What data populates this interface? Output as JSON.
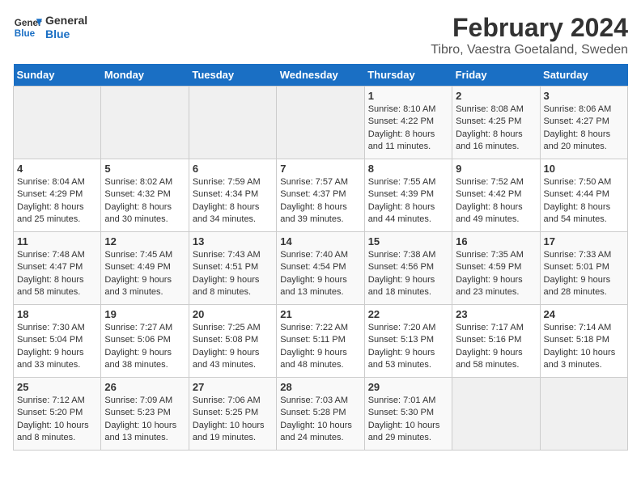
{
  "logo": {
    "text_general": "General",
    "text_blue": "Blue"
  },
  "header": {
    "title": "February 2024",
    "subtitle": "Tibro, Vaestra Goetaland, Sweden"
  },
  "weekdays": [
    "Sunday",
    "Monday",
    "Tuesday",
    "Wednesday",
    "Thursday",
    "Friday",
    "Saturday"
  ],
  "weeks": [
    [
      {
        "day": "",
        "info": ""
      },
      {
        "day": "",
        "info": ""
      },
      {
        "day": "",
        "info": ""
      },
      {
        "day": "",
        "info": ""
      },
      {
        "day": "1",
        "info": "Sunrise: 8:10 AM\nSunset: 4:22 PM\nDaylight: 8 hours\nand 11 minutes."
      },
      {
        "day": "2",
        "info": "Sunrise: 8:08 AM\nSunset: 4:25 PM\nDaylight: 8 hours\nand 16 minutes."
      },
      {
        "day": "3",
        "info": "Sunrise: 8:06 AM\nSunset: 4:27 PM\nDaylight: 8 hours\nand 20 minutes."
      }
    ],
    [
      {
        "day": "4",
        "info": "Sunrise: 8:04 AM\nSunset: 4:29 PM\nDaylight: 8 hours\nand 25 minutes."
      },
      {
        "day": "5",
        "info": "Sunrise: 8:02 AM\nSunset: 4:32 PM\nDaylight: 8 hours\nand 30 minutes."
      },
      {
        "day": "6",
        "info": "Sunrise: 7:59 AM\nSunset: 4:34 PM\nDaylight: 8 hours\nand 34 minutes."
      },
      {
        "day": "7",
        "info": "Sunrise: 7:57 AM\nSunset: 4:37 PM\nDaylight: 8 hours\nand 39 minutes."
      },
      {
        "day": "8",
        "info": "Sunrise: 7:55 AM\nSunset: 4:39 PM\nDaylight: 8 hours\nand 44 minutes."
      },
      {
        "day": "9",
        "info": "Sunrise: 7:52 AM\nSunset: 4:42 PM\nDaylight: 8 hours\nand 49 minutes."
      },
      {
        "day": "10",
        "info": "Sunrise: 7:50 AM\nSunset: 4:44 PM\nDaylight: 8 hours\nand 54 minutes."
      }
    ],
    [
      {
        "day": "11",
        "info": "Sunrise: 7:48 AM\nSunset: 4:47 PM\nDaylight: 8 hours\nand 58 minutes."
      },
      {
        "day": "12",
        "info": "Sunrise: 7:45 AM\nSunset: 4:49 PM\nDaylight: 9 hours\nand 3 minutes."
      },
      {
        "day": "13",
        "info": "Sunrise: 7:43 AM\nSunset: 4:51 PM\nDaylight: 9 hours\nand 8 minutes."
      },
      {
        "day": "14",
        "info": "Sunrise: 7:40 AM\nSunset: 4:54 PM\nDaylight: 9 hours\nand 13 minutes."
      },
      {
        "day": "15",
        "info": "Sunrise: 7:38 AM\nSunset: 4:56 PM\nDaylight: 9 hours\nand 18 minutes."
      },
      {
        "day": "16",
        "info": "Sunrise: 7:35 AM\nSunset: 4:59 PM\nDaylight: 9 hours\nand 23 minutes."
      },
      {
        "day": "17",
        "info": "Sunrise: 7:33 AM\nSunset: 5:01 PM\nDaylight: 9 hours\nand 28 minutes."
      }
    ],
    [
      {
        "day": "18",
        "info": "Sunrise: 7:30 AM\nSunset: 5:04 PM\nDaylight: 9 hours\nand 33 minutes."
      },
      {
        "day": "19",
        "info": "Sunrise: 7:27 AM\nSunset: 5:06 PM\nDaylight: 9 hours\nand 38 minutes."
      },
      {
        "day": "20",
        "info": "Sunrise: 7:25 AM\nSunset: 5:08 PM\nDaylight: 9 hours\nand 43 minutes."
      },
      {
        "day": "21",
        "info": "Sunrise: 7:22 AM\nSunset: 5:11 PM\nDaylight: 9 hours\nand 48 minutes."
      },
      {
        "day": "22",
        "info": "Sunrise: 7:20 AM\nSunset: 5:13 PM\nDaylight: 9 hours\nand 53 minutes."
      },
      {
        "day": "23",
        "info": "Sunrise: 7:17 AM\nSunset: 5:16 PM\nDaylight: 9 hours\nand 58 minutes."
      },
      {
        "day": "24",
        "info": "Sunrise: 7:14 AM\nSunset: 5:18 PM\nDaylight: 10 hours\nand 3 minutes."
      }
    ],
    [
      {
        "day": "25",
        "info": "Sunrise: 7:12 AM\nSunset: 5:20 PM\nDaylight: 10 hours\nand 8 minutes."
      },
      {
        "day": "26",
        "info": "Sunrise: 7:09 AM\nSunset: 5:23 PM\nDaylight: 10 hours\nand 13 minutes."
      },
      {
        "day": "27",
        "info": "Sunrise: 7:06 AM\nSunset: 5:25 PM\nDaylight: 10 hours\nand 19 minutes."
      },
      {
        "day": "28",
        "info": "Sunrise: 7:03 AM\nSunset: 5:28 PM\nDaylight: 10 hours\nand 24 minutes."
      },
      {
        "day": "29",
        "info": "Sunrise: 7:01 AM\nSunset: 5:30 PM\nDaylight: 10 hours\nand 29 minutes."
      },
      {
        "day": "",
        "info": ""
      },
      {
        "day": "",
        "info": ""
      }
    ]
  ]
}
